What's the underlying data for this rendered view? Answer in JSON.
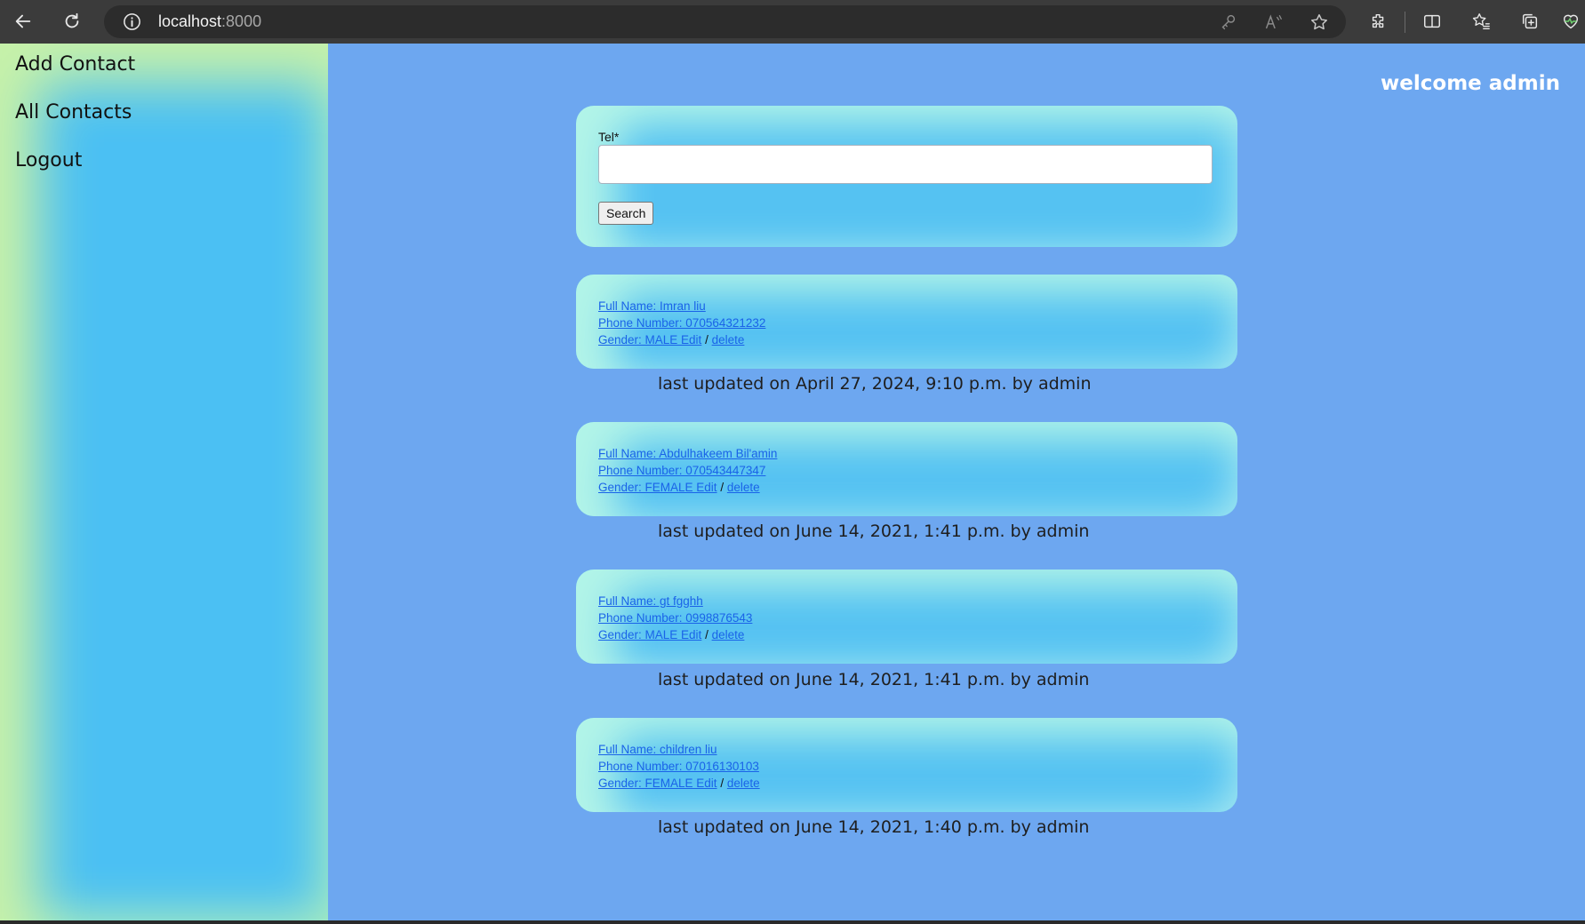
{
  "browser": {
    "url_host": "localhost",
    "url_port": ":8000"
  },
  "sidebar": {
    "items": [
      {
        "label": "Add Contact"
      },
      {
        "label": "All Contacts"
      },
      {
        "label": "Logout"
      }
    ]
  },
  "header": {
    "welcome": "welcome admin"
  },
  "search": {
    "label": "Tel*",
    "value": "",
    "button_label": "Search"
  },
  "contacts": [
    {
      "full_name": "Full Name: Imran liu",
      "phone": "Phone Number: 070564321232",
      "gender_edit": "Gender: MALE Edit",
      "separator": "/",
      "delete_label": "delete",
      "updated": "last updated on April 27, 2024, 9:10 p.m. by admin"
    },
    {
      "full_name": "Full Name: Abdulhakeem Bil'amin",
      "phone": "Phone Number: 070543447347",
      "gender_edit": "Gender: FEMALE Edit",
      "separator": "/",
      "delete_label": "delete",
      "updated": "last updated on June 14, 2021, 1:41 p.m. by admin"
    },
    {
      "full_name": "Full Name: gt fgghh",
      "phone": "Phone Number: 0998876543",
      "gender_edit": "Gender: MALE Edit",
      "separator": "/",
      "delete_label": "delete",
      "updated": "last updated on June 14, 2021, 1:41 p.m. by admin"
    },
    {
      "full_name": "Full Name: children liu",
      "phone": "Phone Number: 07016130103",
      "gender_edit": "Gender: FEMALE Edit",
      "separator": "/",
      "delete_label": "delete",
      "updated": "last updated on June 14, 2021, 1:40 p.m. by admin"
    }
  ],
  "colors": {
    "page_background": "#6da7f0",
    "card_background": "#55c2f2",
    "link": "#1a63e8"
  }
}
